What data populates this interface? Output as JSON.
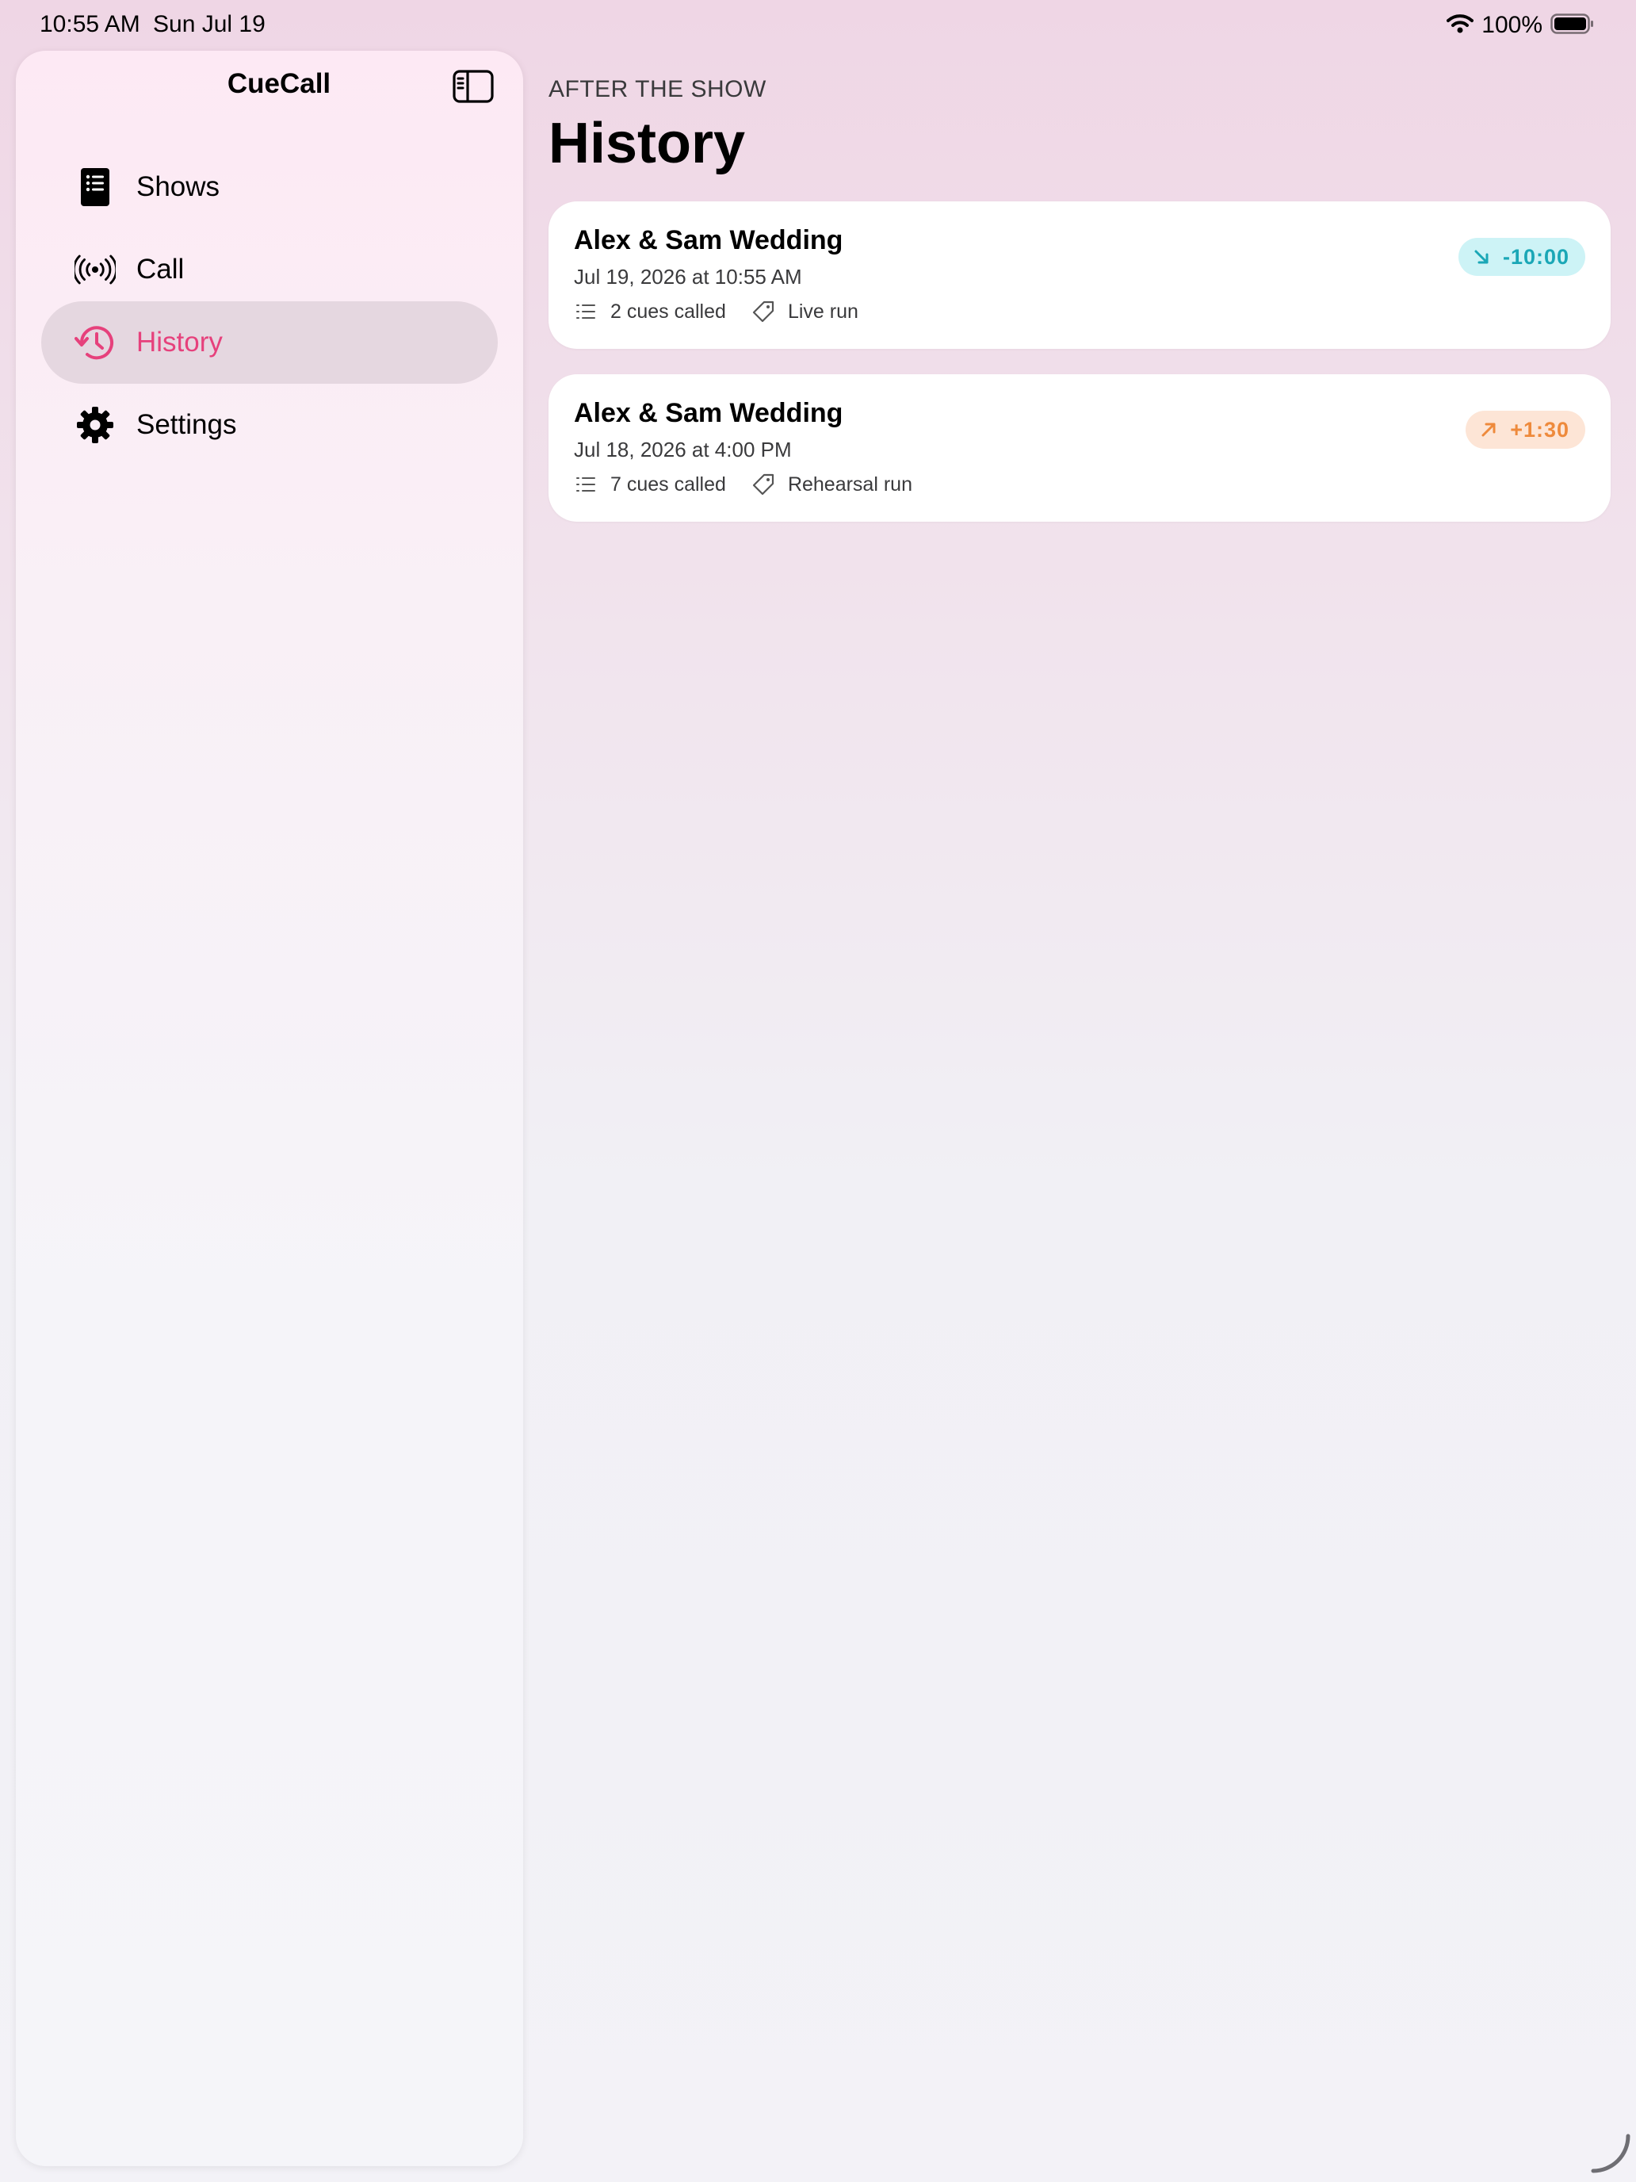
{
  "status_bar": {
    "time": "10:55 AM",
    "date": "Sun Jul 19",
    "battery": "100%",
    "wifi_icon": "wifi-icon",
    "battery_icon": "battery-icon"
  },
  "sidebar": {
    "title": "CueCall",
    "toggle_icon": "sidebar-toggle-icon",
    "items": [
      {
        "label": "Shows",
        "icon": "book-list-icon",
        "active": false
      },
      {
        "label": "Call",
        "icon": "broadcast-icon",
        "active": false
      },
      {
        "label": "History",
        "icon": "history-clock-icon",
        "active": true
      },
      {
        "label": "Settings",
        "icon": "gear-icon",
        "active": false
      }
    ]
  },
  "main": {
    "eyebrow": "AFTER THE SHOW",
    "title": "History",
    "runs": [
      {
        "title": "Alex & Sam Wedding",
        "date": "Jul 19, 2026 at 10:55 AM",
        "cues": "2 cues called",
        "run_type": "Live run",
        "delta": "-10:00",
        "delta_icon": "arrow-down-right-icon",
        "delta_color": "#1aa7b6"
      },
      {
        "title": "Alex & Sam Wedding",
        "date": "Jul 18, 2026 at 4:00 PM",
        "cues": "7 cues called",
        "run_type": "Rehearsal run",
        "delta": "+1:30",
        "delta_icon": "arrow-up-right-icon",
        "delta_color": "#ee8a3c"
      }
    ]
  },
  "colors": {
    "accent": "#e6417c",
    "active_row": "#e5d7e0",
    "early_badge_bg": "#cdf3f6",
    "late_badge_bg": "#fde5d6"
  }
}
